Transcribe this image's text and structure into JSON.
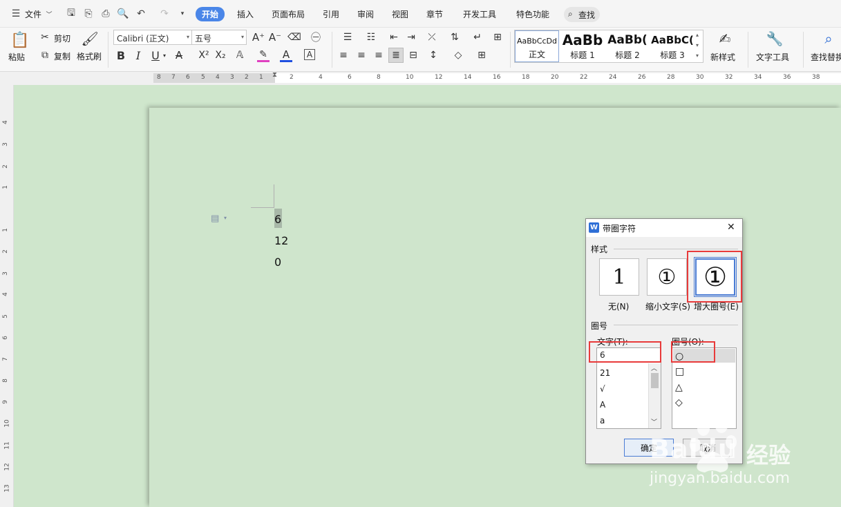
{
  "menubar": {
    "file_label": "文件",
    "tabs": [
      "开始",
      "插入",
      "页面布局",
      "引用",
      "审阅",
      "视图",
      "章节",
      "开发工具",
      "特色功能"
    ],
    "active_tab": "开始",
    "search_label": "查找"
  },
  "ribbon": {
    "paste": "粘贴",
    "cut": "剪切",
    "copy": "复制",
    "format_painter": "格式刷",
    "font_name": "Calibri (正文)",
    "font_size": "五号",
    "bold": "B",
    "italic": "I",
    "underline": "U",
    "font_color_letter": "A",
    "superscript": "X²",
    "subscript": "X₂",
    "char_border": "A",
    "styles": [
      {
        "preview": "AaBbCcDd",
        "name": "正文"
      },
      {
        "preview": "AaBb",
        "name": "标题 1"
      },
      {
        "preview": "AaBb(",
        "name": "标题 2"
      },
      {
        "preview": "AaBbC(",
        "name": "标题 3"
      }
    ],
    "new_style": "新样式",
    "text_tools": "文字工具",
    "find_replace": "查找替换"
  },
  "ruler": {
    "h_ticks": [
      "8",
      "7",
      "6",
      "5",
      "4",
      "3",
      "2",
      "1",
      "2",
      "4",
      "6",
      "8",
      "10",
      "12",
      "14",
      "16",
      "18",
      "20",
      "22",
      "24",
      "26",
      "28",
      "30",
      "32",
      "34",
      "36",
      "38"
    ],
    "v_ticks": [
      "4",
      "3",
      "2",
      "1",
      "1",
      "2",
      "3",
      "4",
      "5",
      "6",
      "7",
      "8",
      "9",
      "10",
      "11",
      "12",
      "13"
    ]
  },
  "document": {
    "lines": [
      "6",
      "12",
      "0"
    ]
  },
  "dialog": {
    "title": "带圈字符",
    "style_group": "样式",
    "styles": [
      {
        "glyph": "1",
        "label": "无(N)"
      },
      {
        "glyph": "①",
        "label": "缩小文字(S)"
      },
      {
        "glyph": "①",
        "label": "增大圈号(E)"
      }
    ],
    "circle_group": "圈号",
    "text_label": "文字(T):",
    "text_value": "6",
    "text_list": [
      "21",
      "√",
      "A",
      "a"
    ],
    "enclosure_label": "圈号(O):",
    "enclosure_list": [
      "○",
      "□",
      "△",
      "◇"
    ],
    "ok_label": "确定",
    "cancel_label": "取消",
    "close_glyph": "✕"
  },
  "watermark": {
    "brand": "Baidu",
    "brand_cn": "经验",
    "url": "jingyan.baidu.com"
  },
  "colors": {
    "accent": "#4a86e8",
    "highlight": "#e83a3a",
    "doc_bg": "#cfe6cc"
  }
}
